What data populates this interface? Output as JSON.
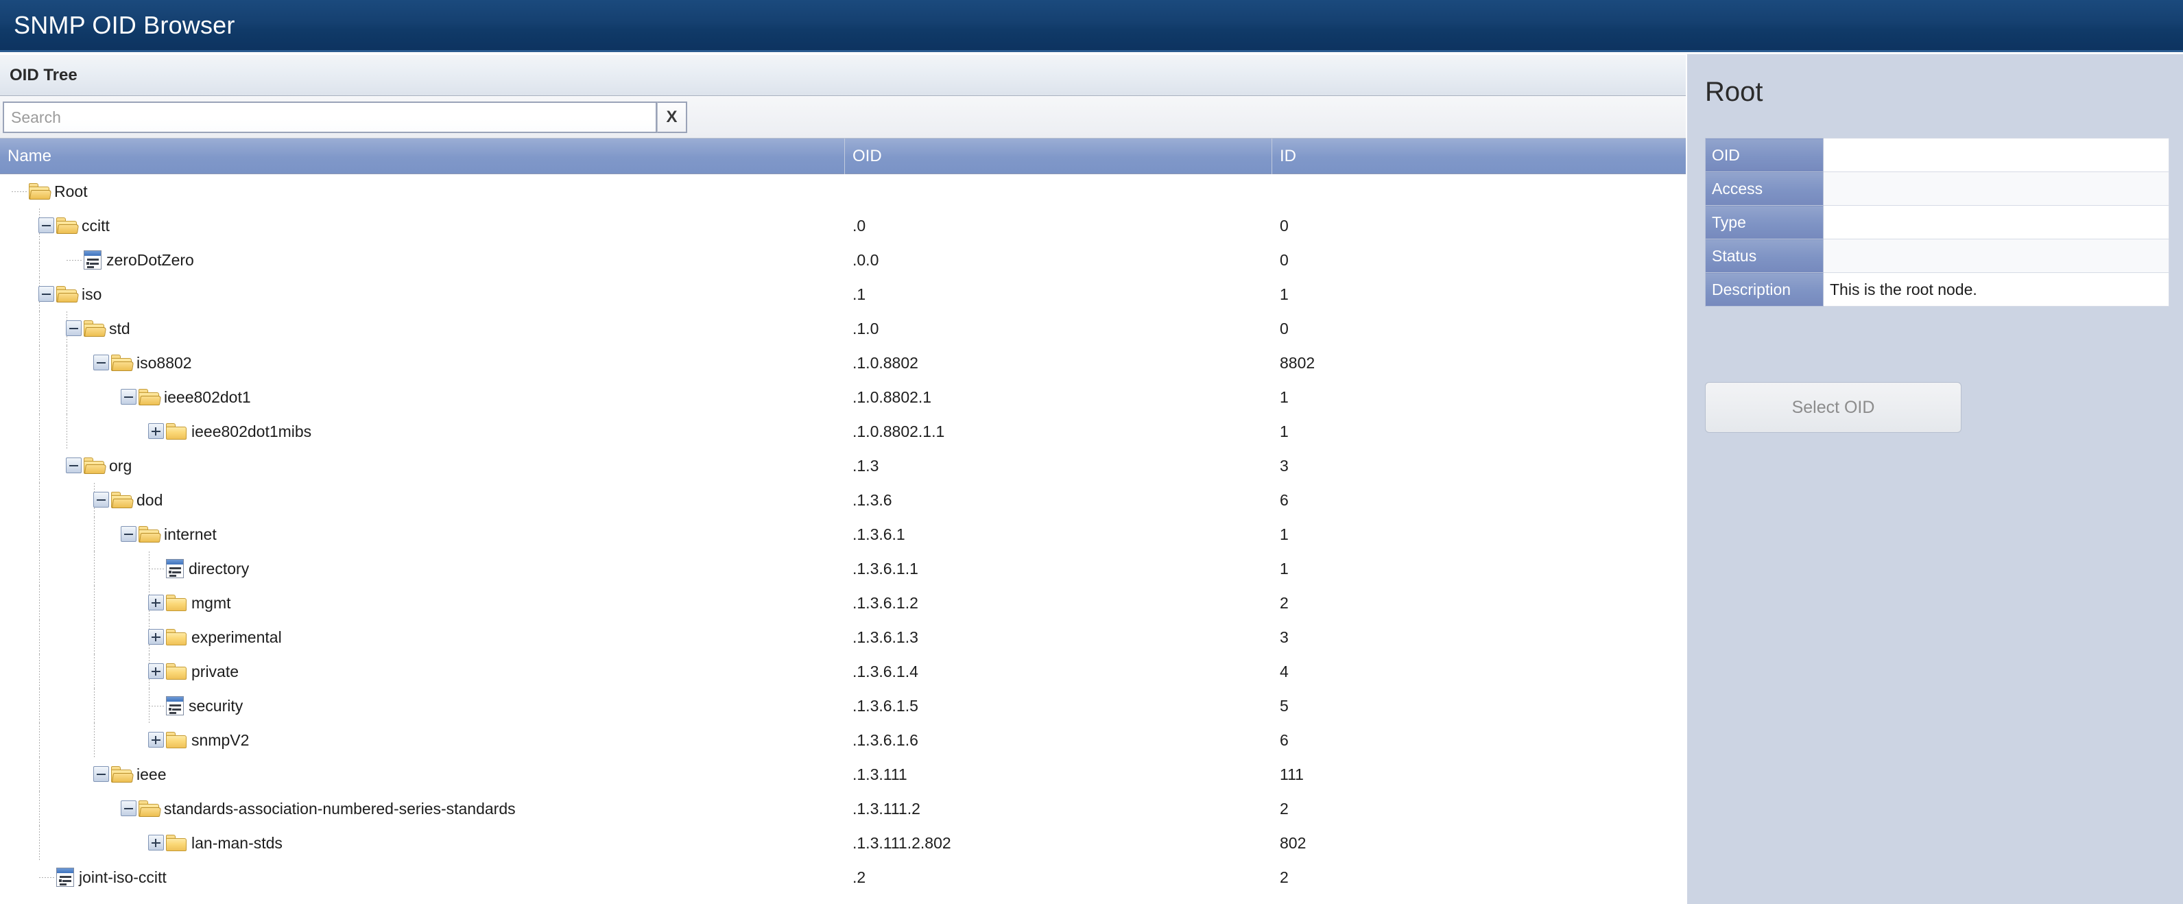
{
  "app": {
    "title": "SNMP OID Browser",
    "header_bg": "#154070"
  },
  "tree_panel": {
    "title": "OID Tree",
    "search": {
      "value": "",
      "placeholder": "Search",
      "clear_label": "X"
    },
    "columns": [
      {
        "key": "name",
        "label": "Name"
      },
      {
        "key": "oid",
        "label": "OID"
      },
      {
        "key": "id",
        "label": "ID"
      }
    ],
    "rows": [
      {
        "name": "Root",
        "oid": "",
        "id": "",
        "depth": 0,
        "icon": "folder-open-icon",
        "expander": "none"
      },
      {
        "name": "ccitt",
        "oid": ".0",
        "id": "0",
        "depth": 1,
        "icon": "folder-open-icon",
        "expander": "minus"
      },
      {
        "name": "zeroDotZero",
        "oid": ".0.0",
        "id": "0",
        "depth": 2,
        "icon": "leaf-node-icon",
        "expander": "none"
      },
      {
        "name": "iso",
        "oid": ".1",
        "id": "1",
        "depth": 1,
        "icon": "folder-open-icon",
        "expander": "minus"
      },
      {
        "name": "std",
        "oid": ".1.0",
        "id": "0",
        "depth": 2,
        "icon": "folder-open-icon",
        "expander": "minus"
      },
      {
        "name": "iso8802",
        "oid": ".1.0.8802",
        "id": "8802",
        "depth": 3,
        "icon": "folder-open-icon",
        "expander": "minus"
      },
      {
        "name": "ieee802dot1",
        "oid": ".1.0.8802.1",
        "id": "1",
        "depth": 4,
        "icon": "folder-open-icon",
        "expander": "minus"
      },
      {
        "name": "ieee802dot1mibs",
        "oid": ".1.0.8802.1.1",
        "id": "1",
        "depth": 5,
        "icon": "folder-closed-icon",
        "expander": "plus"
      },
      {
        "name": "org",
        "oid": ".1.3",
        "id": "3",
        "depth": 2,
        "icon": "folder-open-icon",
        "expander": "minus"
      },
      {
        "name": "dod",
        "oid": ".1.3.6",
        "id": "6",
        "depth": 3,
        "icon": "folder-open-icon",
        "expander": "minus"
      },
      {
        "name": "internet",
        "oid": ".1.3.6.1",
        "id": "1",
        "depth": 4,
        "icon": "folder-open-icon",
        "expander": "minus"
      },
      {
        "name": "directory",
        "oid": ".1.3.6.1.1",
        "id": "1",
        "depth": 5,
        "icon": "leaf-node-icon",
        "expander": "none"
      },
      {
        "name": "mgmt",
        "oid": ".1.3.6.1.2",
        "id": "2",
        "depth": 5,
        "icon": "folder-closed-icon",
        "expander": "plus"
      },
      {
        "name": "experimental",
        "oid": ".1.3.6.1.3",
        "id": "3",
        "depth": 5,
        "icon": "folder-closed-icon",
        "expander": "plus"
      },
      {
        "name": "private",
        "oid": ".1.3.6.1.4",
        "id": "4",
        "depth": 5,
        "icon": "folder-closed-icon",
        "expander": "plus"
      },
      {
        "name": "security",
        "oid": ".1.3.6.1.5",
        "id": "5",
        "depth": 5,
        "icon": "leaf-node-icon",
        "expander": "none"
      },
      {
        "name": "snmpV2",
        "oid": ".1.3.6.1.6",
        "id": "6",
        "depth": 5,
        "icon": "folder-closed-icon",
        "expander": "plus"
      },
      {
        "name": "ieee",
        "oid": ".1.3.111",
        "id": "111",
        "depth": 3,
        "icon": "folder-open-icon",
        "expander": "minus"
      },
      {
        "name": "standards-association-numbered-series-standards",
        "oid": ".1.3.111.2",
        "id": "2",
        "depth": 4,
        "icon": "folder-open-icon",
        "expander": "minus"
      },
      {
        "name": "lan-man-stds",
        "oid": ".1.3.111.2.802",
        "id": "802",
        "depth": 5,
        "icon": "folder-closed-icon",
        "expander": "plus"
      },
      {
        "name": "joint-iso-ccitt",
        "oid": ".2",
        "id": "2",
        "depth": 1,
        "icon": "leaf-node-icon",
        "expander": "none"
      }
    ]
  },
  "detail_panel": {
    "title": "Root",
    "fields": [
      {
        "label": "OID",
        "value": ""
      },
      {
        "label": "Access",
        "value": ""
      },
      {
        "label": "Type",
        "value": ""
      },
      {
        "label": "Status",
        "value": ""
      },
      {
        "label": "Description",
        "value": "This is the root node."
      }
    ],
    "select_button": {
      "label": "Select OID",
      "disabled": true
    }
  }
}
